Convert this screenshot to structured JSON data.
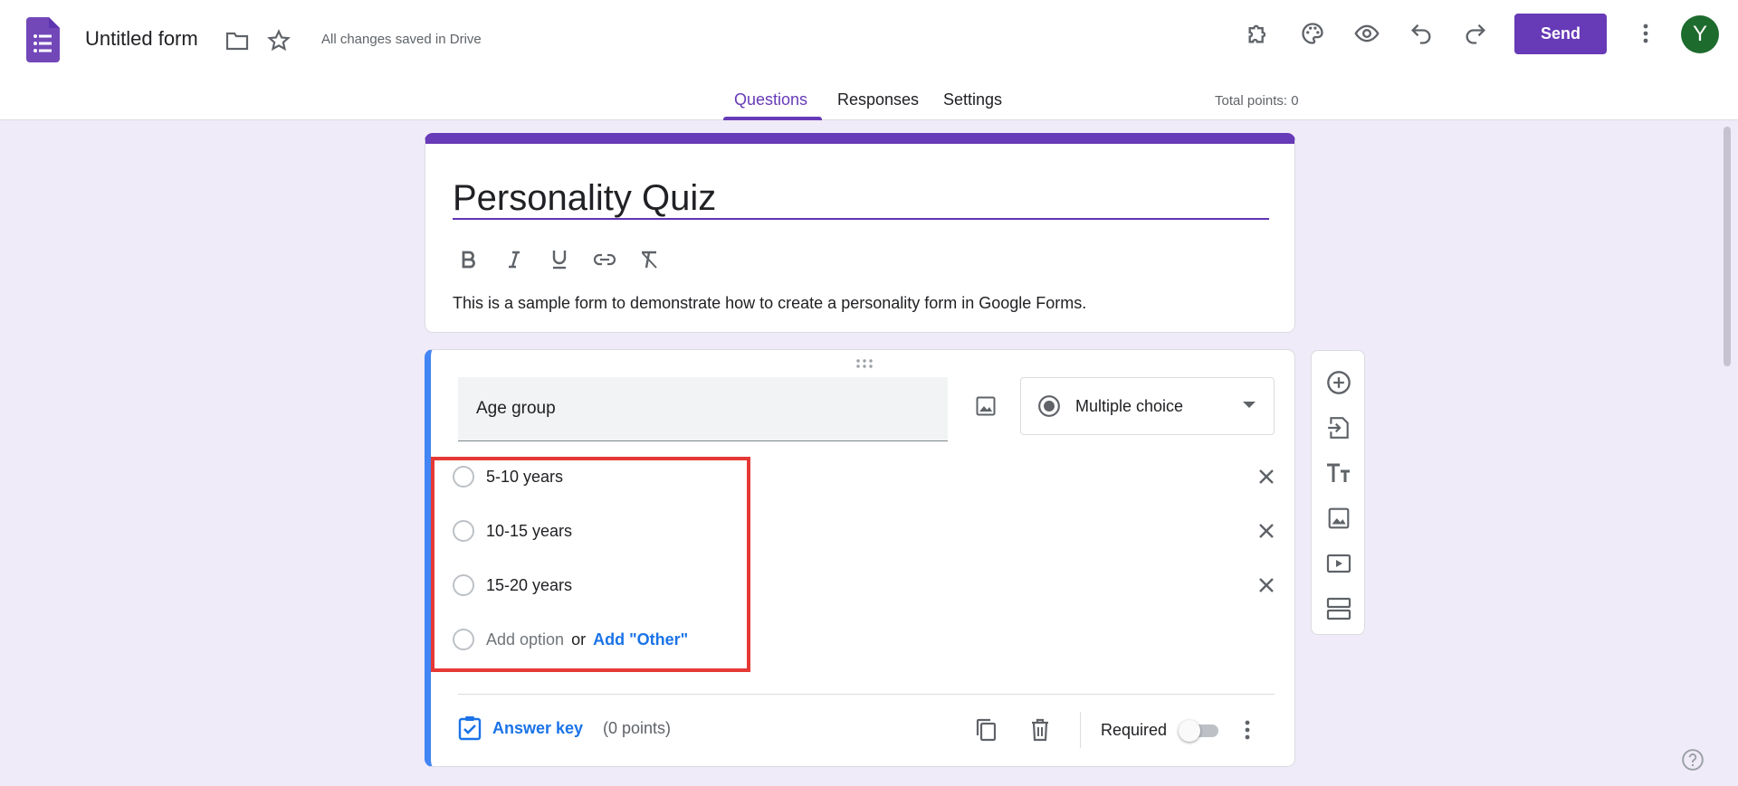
{
  "header": {
    "form_title": "Untitled form",
    "save_status": "All changes saved in Drive",
    "send_label": "Send",
    "avatar_initial": "Y"
  },
  "tabs": [
    {
      "label": "Questions",
      "active": true
    },
    {
      "label": "Responses",
      "active": false
    },
    {
      "label": "Settings",
      "active": false
    }
  ],
  "total_points": "Total points: 0",
  "title_card": {
    "title": "Personality Quiz",
    "description": "This is a sample form to demonstrate how to create a personality form in Google Forms."
  },
  "question": {
    "title": "Age group",
    "type": "Multiple choice",
    "options": [
      {
        "label": "5-10 years"
      },
      {
        "label": "10-15 years"
      },
      {
        "label": "15-20 years"
      }
    ],
    "add_option": "Add option",
    "or_text": "or",
    "add_other": "Add \"Other\"",
    "answer_key": "Answer key",
    "points": "(0 points)",
    "required_label": "Required",
    "required": false
  },
  "colors": {
    "accent": "#673ab7",
    "background": "#f0ebf8",
    "question_accent": "#4285f4",
    "link": "#1a73e8",
    "highlight": "#e53935",
    "avatar": "#1e6b2e"
  }
}
